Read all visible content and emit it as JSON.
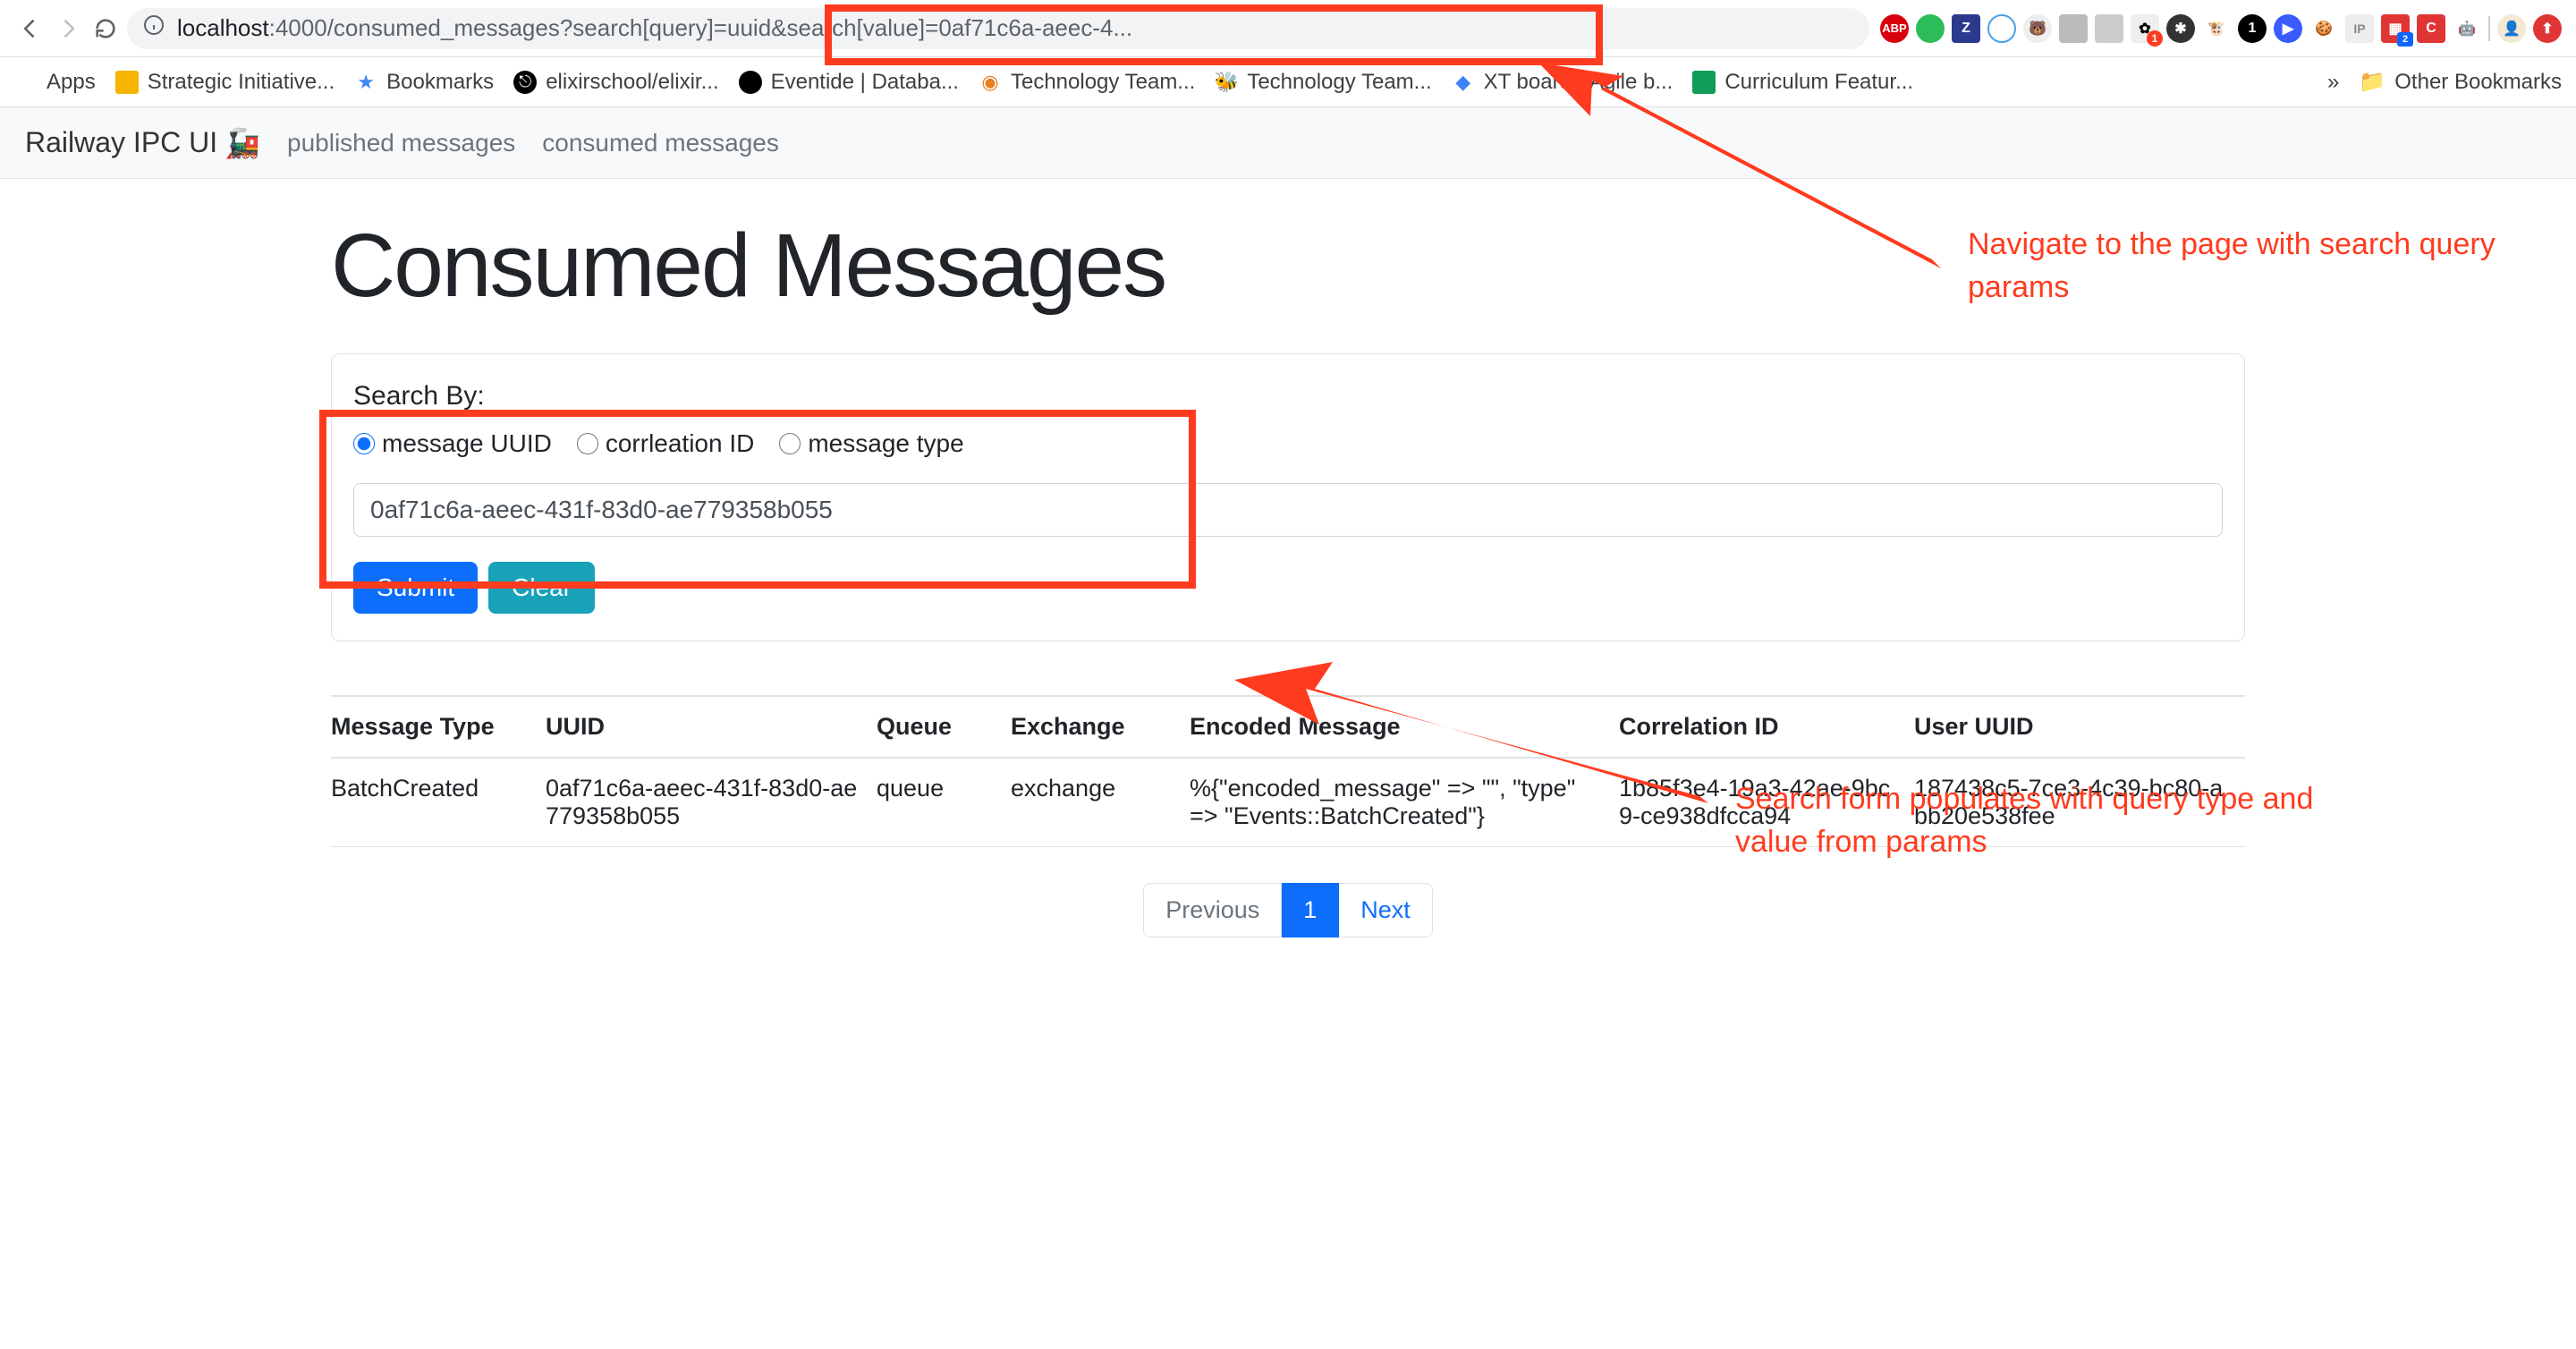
{
  "browser": {
    "url_host": "localhost",
    "url_port_path": ":4000/consumed_message",
    "url_query_trunc": "s?search[query]=uuid&search[value]=0af71c6a-aeec-4..."
  },
  "bookmarks": {
    "apps": "Apps",
    "items": [
      "Strategic Initiative...",
      "Bookmarks",
      "elixirschool/elixir...",
      "Eventide | Databa...",
      "Technology Team...",
      "Technology Team...",
      "XT board - Agile b...",
      "Curriculum Featur..."
    ],
    "overflow": "»",
    "other": "Other Bookmarks"
  },
  "nav": {
    "brand": "Railway IPC UI",
    "brand_emoji": "🚂",
    "published": "published messages",
    "consumed": "consumed messages"
  },
  "page_title": "Consumed Messages",
  "search": {
    "label": "Search By:",
    "radio_uuid": "message UUID",
    "radio_corr": "corrleation ID",
    "radio_type": "message type",
    "value": "0af71c6a-aeec-431f-83d0-ae779358b055",
    "submit": "Submit",
    "clear": "Clear"
  },
  "table": {
    "headers": [
      "Message Type",
      "UUID",
      "Queue",
      "Exchange",
      "Encoded Message",
      "Correlation ID",
      "User UUID"
    ],
    "rows": [
      {
        "type": "BatchCreated",
        "uuid": "0af71c6a-aeec-431f-83d0-ae779358b055",
        "queue": "queue",
        "exchange": "exchange",
        "encoded": "%{\"encoded_message\" => \"\", \"type\" => \"Events::BatchCreated\"}",
        "corr": "1b85f3e4-19a3-42ae-9bc9-ce938dfcca94",
        "user": "187438c5-7ce3-4c39-bc80-abb20e538fee"
      }
    ]
  },
  "pagination": {
    "prev": "Previous",
    "page": "1",
    "next": "Next"
  },
  "annotations": {
    "top": "Navigate to the page with search query params",
    "mid": "Search form populates with query type and value from params"
  }
}
